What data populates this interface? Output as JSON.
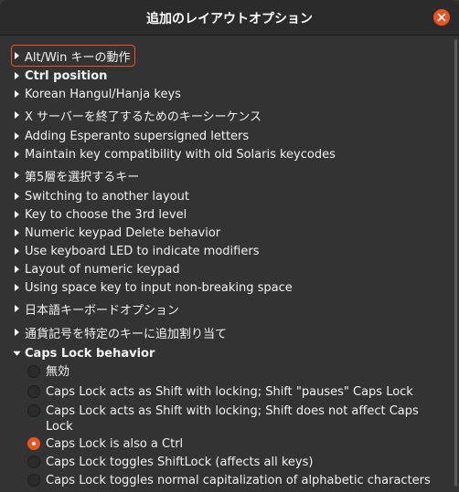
{
  "window": {
    "title": "追加のレイアウトオプション"
  },
  "colors": {
    "accent": "#e95420",
    "background": "#333333",
    "titlebar": "#2b2b2b",
    "text": "#ffffff"
  },
  "tree": {
    "items": [
      {
        "label": "Alt/Win キーの動作",
        "expanded": false,
        "bold": false
      },
      {
        "label": "Ctrl position",
        "expanded": false,
        "bold": true
      },
      {
        "label": "Korean Hangul/Hanja keys",
        "expanded": false,
        "bold": false
      },
      {
        "label": "X サーバーを終了するためのキーシーケンス",
        "expanded": false,
        "bold": false
      },
      {
        "label": "Adding Esperanto supersigned letters",
        "expanded": false,
        "bold": false
      },
      {
        "label": "Maintain key compatibility with old Solaris keycodes",
        "expanded": false,
        "bold": false
      },
      {
        "label": "第5層を選択するキー",
        "expanded": false,
        "bold": false
      },
      {
        "label": "Switching to another layout",
        "expanded": false,
        "bold": false
      },
      {
        "label": "Key to choose the 3rd level",
        "expanded": false,
        "bold": false
      },
      {
        "label": "Numeric keypad Delete behavior",
        "expanded": false,
        "bold": false
      },
      {
        "label": "Use keyboard LED to indicate modifiers",
        "expanded": false,
        "bold": false
      },
      {
        "label": "Layout of numeric keypad",
        "expanded": false,
        "bold": false
      },
      {
        "label": "Using space key to input non-breaking space",
        "expanded": false,
        "bold": false
      },
      {
        "label": "日本語キーボードオプション",
        "expanded": false,
        "bold": false
      },
      {
        "label": "通貨記号を特定のキーに追加割り当て",
        "expanded": false,
        "bold": false
      },
      {
        "label": "Caps Lock behavior",
        "expanded": true,
        "bold": true
      }
    ],
    "caps_lock_options": [
      {
        "label": "無効",
        "checked": false
      },
      {
        "label": "Caps Lock acts as Shift with locking; Shift \"pauses\" Caps Lock",
        "checked": false
      },
      {
        "label": "Caps Lock acts as Shift with locking; Shift does not affect Caps Lock",
        "checked": false
      },
      {
        "label": "Caps Lock is also a Ctrl",
        "checked": true
      },
      {
        "label": "Caps Lock toggles ShiftLock (affects all keys)",
        "checked": false
      },
      {
        "label": "Caps Lock toggles normal capitalization of alphabetic characters",
        "checked": false
      }
    ]
  }
}
